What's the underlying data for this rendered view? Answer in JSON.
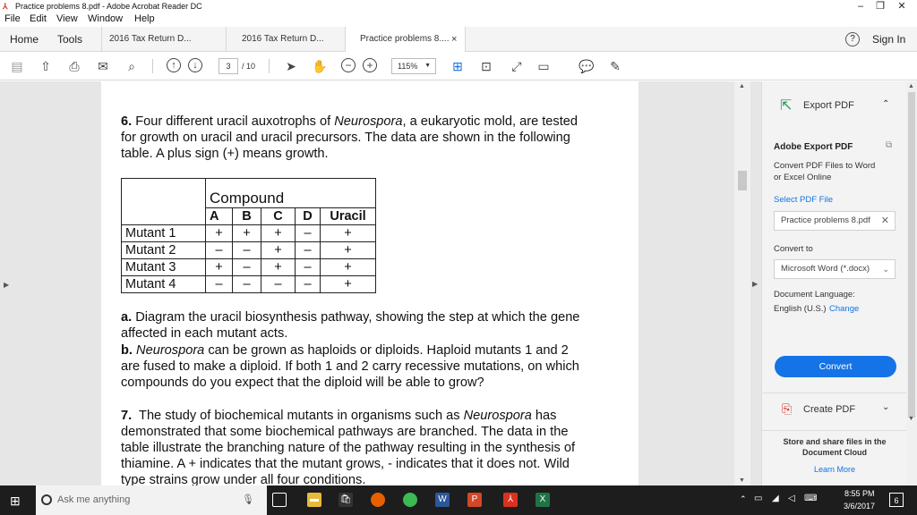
{
  "window": {
    "title": "Practice problems 8.pdf - Adobe Acrobat Reader DC",
    "minimize": "–",
    "restore": "❐",
    "close": "✕"
  },
  "menu": [
    "File",
    "Edit",
    "View",
    "Window",
    "Help"
  ],
  "nav": {
    "home": "Home",
    "tools": "Tools"
  },
  "tabs": [
    {
      "label": "2016 Tax Return D...",
      "active": false
    },
    {
      "label": "2016 Tax Return D...",
      "active": false
    },
    {
      "label": "Practice problems 8....",
      "active": true,
      "close": "×"
    }
  ],
  "help_icon": "?",
  "signin": "Sign In",
  "toolbar": {
    "page_current": "3",
    "page_total": "/ 10",
    "zoom": "115%"
  },
  "doc": {
    "q6_num": "6.",
    "q6_line1_a": "Four different uracil auxotrophs of ",
    "q6_line1_i": "Neurospora",
    "q6_line1_b": ", a eukaryotic mold, are tested",
    "q6_line2": "for growth on uracil and uracil precursors.  The data are shown in the following",
    "q6_line3": "table.  A plus sign (+) means growth.",
    "table": {
      "header_group": "Compound",
      "columns": [
        "A",
        "B",
        "C",
        "D",
        "Uracil"
      ],
      "rows": [
        {
          "name": "Mutant 1",
          "cells": [
            "+",
            "+",
            "+",
            "–",
            "+"
          ]
        },
        {
          "name": "Mutant 2",
          "cells": [
            "–",
            "–",
            "+",
            "–",
            "+"
          ]
        },
        {
          "name": "Mutant 3",
          "cells": [
            "+",
            "–",
            "+",
            "–",
            "+"
          ]
        },
        {
          "name": "Mutant 4",
          "cells": [
            "–",
            "–",
            "–",
            "–",
            "+"
          ]
        }
      ]
    },
    "a_label": "a.",
    "a_line1": "Diagram the uracil biosynthesis pathway, showing the step at which the gene",
    "a_line2": "affected in each mutant acts.",
    "b_label": "b.",
    "b_line1_i": "Neurospora",
    "b_line1_b": " can be grown as haploids or diploids.  Haploid mutants 1 and 2",
    "b_line2": "are fused to make a diploid.  If both 1 and 2 carry recessive mutations, on which",
    "b_line3": "compounds do you expect that the diploid will be able to grow?",
    "q7_num": "7.",
    "q7_line1_a": "The study of biochemical mutants in organisms such as ",
    "q7_line1_i": "Neurospora",
    "q7_line1_b": " has",
    "q7_line2": "demonstrated that some biochemical pathways are branched.  The data in the",
    "q7_line3": "table illustrate the branching nature of the pathway resulting in the synthesis of",
    "q7_line4": "thiamine.  A + indicates that the mutant grows, - indicates that it does not.  Wild",
    "q7_line5": "type strains grow under all four conditions."
  },
  "panel": {
    "export_title": "Export PDF",
    "heading": "Adobe Export PDF",
    "desc1": "Convert PDF Files to Word",
    "desc2": "or Excel Online",
    "select_label": "Select PDF File",
    "file_name": "Practice problems 8.pdf",
    "convert_to": "Convert to",
    "format": "Microsoft Word (*.docx)",
    "doc_lang": "Document Language:",
    "lang": "English (U.S.)",
    "change": "Change",
    "convert_btn": "Convert",
    "create_pdf": "Create PDF",
    "store1": "Store and share files in the",
    "store2": "Document Cloud",
    "learn_more": "Learn More"
  },
  "taskbar": {
    "search": "Ask me anything",
    "time": "8:55 PM",
    "date": "3/6/2017",
    "notif": "6"
  },
  "colors": {
    "accent": "#1473e6",
    "acrobat_red": "#d9321f",
    "taskbar": "#1d1d1d"
  }
}
